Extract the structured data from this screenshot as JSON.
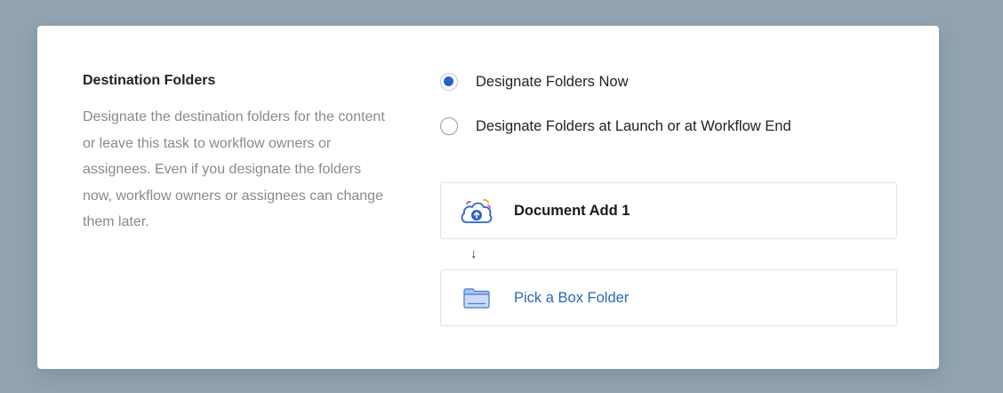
{
  "section": {
    "title": "Destination Folders",
    "description": "Designate the destination folders for the content or leave this task to workflow owners or assignees. Even if you designate the folders now, workflow owners or assignees can change them later."
  },
  "options": [
    {
      "label": "Designate Folders Now",
      "selected": true
    },
    {
      "label": "Designate Folders at Launch or at Workflow End",
      "selected": false
    }
  ],
  "document_step": {
    "label": "Document Add 1",
    "icon": "cloud-upload-icon"
  },
  "flow_arrow": "↓",
  "folder_step": {
    "label": "Pick a Box Folder",
    "icon": "folder-icon"
  },
  "colors": {
    "accent": "#2c61c9",
    "link": "#2a6ab3",
    "background": "#91a3b0"
  }
}
